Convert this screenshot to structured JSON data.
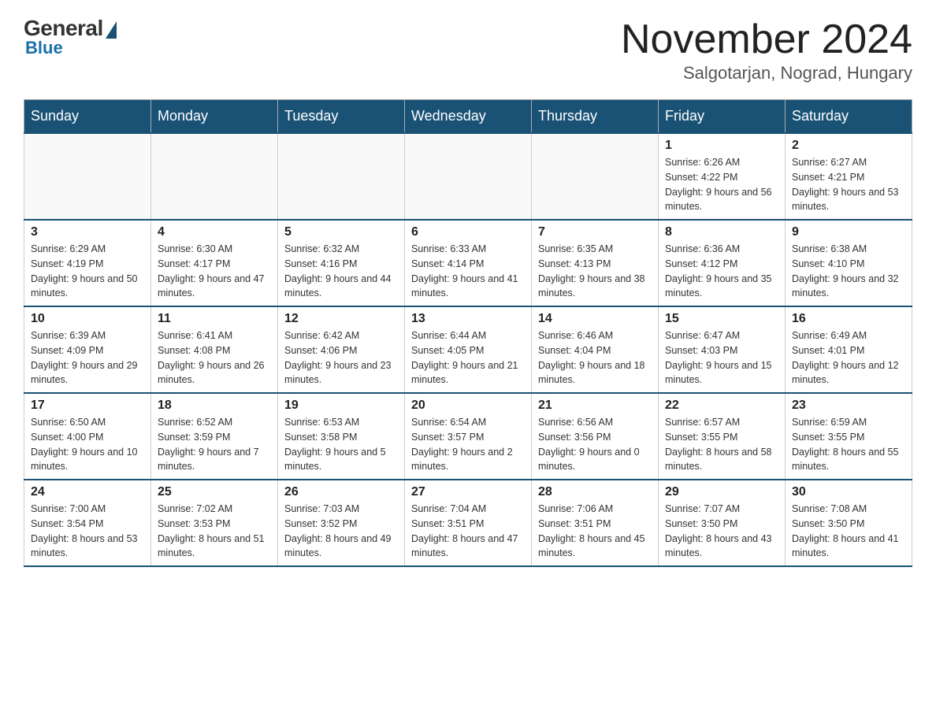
{
  "logo": {
    "general": "General",
    "blue": "Blue"
  },
  "title": {
    "month": "November 2024",
    "location": "Salgotarjan, Nograd, Hungary"
  },
  "weekdays": [
    "Sunday",
    "Monday",
    "Tuesday",
    "Wednesday",
    "Thursday",
    "Friday",
    "Saturday"
  ],
  "weeks": [
    [
      {
        "day": "",
        "info": ""
      },
      {
        "day": "",
        "info": ""
      },
      {
        "day": "",
        "info": ""
      },
      {
        "day": "",
        "info": ""
      },
      {
        "day": "",
        "info": ""
      },
      {
        "day": "1",
        "info": "Sunrise: 6:26 AM\nSunset: 4:22 PM\nDaylight: 9 hours and 56 minutes."
      },
      {
        "day": "2",
        "info": "Sunrise: 6:27 AM\nSunset: 4:21 PM\nDaylight: 9 hours and 53 minutes."
      }
    ],
    [
      {
        "day": "3",
        "info": "Sunrise: 6:29 AM\nSunset: 4:19 PM\nDaylight: 9 hours and 50 minutes."
      },
      {
        "day": "4",
        "info": "Sunrise: 6:30 AM\nSunset: 4:17 PM\nDaylight: 9 hours and 47 minutes."
      },
      {
        "day": "5",
        "info": "Sunrise: 6:32 AM\nSunset: 4:16 PM\nDaylight: 9 hours and 44 minutes."
      },
      {
        "day": "6",
        "info": "Sunrise: 6:33 AM\nSunset: 4:14 PM\nDaylight: 9 hours and 41 minutes."
      },
      {
        "day": "7",
        "info": "Sunrise: 6:35 AM\nSunset: 4:13 PM\nDaylight: 9 hours and 38 minutes."
      },
      {
        "day": "8",
        "info": "Sunrise: 6:36 AM\nSunset: 4:12 PM\nDaylight: 9 hours and 35 minutes."
      },
      {
        "day": "9",
        "info": "Sunrise: 6:38 AM\nSunset: 4:10 PM\nDaylight: 9 hours and 32 minutes."
      }
    ],
    [
      {
        "day": "10",
        "info": "Sunrise: 6:39 AM\nSunset: 4:09 PM\nDaylight: 9 hours and 29 minutes."
      },
      {
        "day": "11",
        "info": "Sunrise: 6:41 AM\nSunset: 4:08 PM\nDaylight: 9 hours and 26 minutes."
      },
      {
        "day": "12",
        "info": "Sunrise: 6:42 AM\nSunset: 4:06 PM\nDaylight: 9 hours and 23 minutes."
      },
      {
        "day": "13",
        "info": "Sunrise: 6:44 AM\nSunset: 4:05 PM\nDaylight: 9 hours and 21 minutes."
      },
      {
        "day": "14",
        "info": "Sunrise: 6:46 AM\nSunset: 4:04 PM\nDaylight: 9 hours and 18 minutes."
      },
      {
        "day": "15",
        "info": "Sunrise: 6:47 AM\nSunset: 4:03 PM\nDaylight: 9 hours and 15 minutes."
      },
      {
        "day": "16",
        "info": "Sunrise: 6:49 AM\nSunset: 4:01 PM\nDaylight: 9 hours and 12 minutes."
      }
    ],
    [
      {
        "day": "17",
        "info": "Sunrise: 6:50 AM\nSunset: 4:00 PM\nDaylight: 9 hours and 10 minutes."
      },
      {
        "day": "18",
        "info": "Sunrise: 6:52 AM\nSunset: 3:59 PM\nDaylight: 9 hours and 7 minutes."
      },
      {
        "day": "19",
        "info": "Sunrise: 6:53 AM\nSunset: 3:58 PM\nDaylight: 9 hours and 5 minutes."
      },
      {
        "day": "20",
        "info": "Sunrise: 6:54 AM\nSunset: 3:57 PM\nDaylight: 9 hours and 2 minutes."
      },
      {
        "day": "21",
        "info": "Sunrise: 6:56 AM\nSunset: 3:56 PM\nDaylight: 9 hours and 0 minutes."
      },
      {
        "day": "22",
        "info": "Sunrise: 6:57 AM\nSunset: 3:55 PM\nDaylight: 8 hours and 58 minutes."
      },
      {
        "day": "23",
        "info": "Sunrise: 6:59 AM\nSunset: 3:55 PM\nDaylight: 8 hours and 55 minutes."
      }
    ],
    [
      {
        "day": "24",
        "info": "Sunrise: 7:00 AM\nSunset: 3:54 PM\nDaylight: 8 hours and 53 minutes."
      },
      {
        "day": "25",
        "info": "Sunrise: 7:02 AM\nSunset: 3:53 PM\nDaylight: 8 hours and 51 minutes."
      },
      {
        "day": "26",
        "info": "Sunrise: 7:03 AM\nSunset: 3:52 PM\nDaylight: 8 hours and 49 minutes."
      },
      {
        "day": "27",
        "info": "Sunrise: 7:04 AM\nSunset: 3:51 PM\nDaylight: 8 hours and 47 minutes."
      },
      {
        "day": "28",
        "info": "Sunrise: 7:06 AM\nSunset: 3:51 PM\nDaylight: 8 hours and 45 minutes."
      },
      {
        "day": "29",
        "info": "Sunrise: 7:07 AM\nSunset: 3:50 PM\nDaylight: 8 hours and 43 minutes."
      },
      {
        "day": "30",
        "info": "Sunrise: 7:08 AM\nSunset: 3:50 PM\nDaylight: 8 hours and 41 minutes."
      }
    ]
  ]
}
